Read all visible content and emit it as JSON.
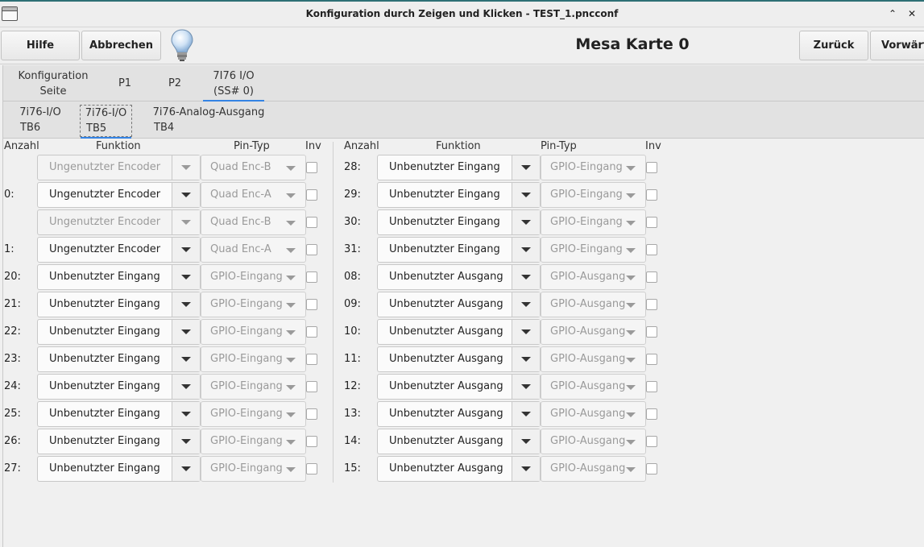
{
  "window": {
    "title": "Konfiguration durch Zeigen und Klicken - TEST_1.pncconf",
    "minimize_glyph": "⌃",
    "close_glyph": "✕"
  },
  "toolbar": {
    "help_label": "Hilfe",
    "cancel_label": "Abbrechen",
    "page_title": "Mesa Karte 0",
    "back_label": "Zurück",
    "forward_label": "Vorwärts"
  },
  "tabs_main": [
    {
      "line1": "Konfiguration",
      "line2": "Seite"
    },
    {
      "line1": "P1",
      "line2": ""
    },
    {
      "line1": "P2",
      "line2": ""
    },
    {
      "line1": "7I76 I/O",
      "line2": "(SS# 0)"
    }
  ],
  "tabs_sub": [
    {
      "line1": "7i76-I/O",
      "line2": "TB6"
    },
    {
      "line1": "7i76-I/O",
      "line2": "TB5"
    },
    {
      "line1": "7i76-Analog-Ausgang",
      "line2": "TB4"
    }
  ],
  "headers": {
    "count": "Anzahl",
    "function": "Funktion",
    "pintype": "Pin-Typ",
    "inv": "Inv"
  },
  "left_rows": [
    {
      "label": "",
      "func": "Ungenutzter Encoder",
      "func_disabled": true,
      "pintype": "Quad Enc-B"
    },
    {
      "label": "0:",
      "func": "Ungenutzter Encoder",
      "func_disabled": false,
      "pintype": "Quad Enc-A"
    },
    {
      "label": "",
      "func": "Ungenutzter Encoder",
      "func_disabled": true,
      "pintype": "Quad Enc-B"
    },
    {
      "label": "1:",
      "func": "Ungenutzter Encoder",
      "func_disabled": false,
      "pintype": "Quad Enc-A"
    },
    {
      "label": "20:",
      "func": "Unbenutzter Eingang",
      "func_disabled": false,
      "pintype": "GPIO-Eingang"
    },
    {
      "label": "21:",
      "func": "Unbenutzter Eingang",
      "func_disabled": false,
      "pintype": "GPIO-Eingang"
    },
    {
      "label": "22:",
      "func": "Unbenutzter Eingang",
      "func_disabled": false,
      "pintype": "GPIO-Eingang"
    },
    {
      "label": "23:",
      "func": "Unbenutzter Eingang",
      "func_disabled": false,
      "pintype": "GPIO-Eingang"
    },
    {
      "label": "24:",
      "func": "Unbenutzter Eingang",
      "func_disabled": false,
      "pintype": "GPIO-Eingang"
    },
    {
      "label": "25:",
      "func": "Unbenutzter Eingang",
      "func_disabled": false,
      "pintype": "GPIO-Eingang"
    },
    {
      "label": "26:",
      "func": "Unbenutzter Eingang",
      "func_disabled": false,
      "pintype": "GPIO-Eingang"
    },
    {
      "label": "27:",
      "func": "Unbenutzter Eingang",
      "func_disabled": false,
      "pintype": "GPIO-Eingang"
    }
  ],
  "right_rows": [
    {
      "label": "28:",
      "func": "Unbenutzter Eingang",
      "func_disabled": false,
      "pintype": "GPIO-Eingang"
    },
    {
      "label": "29:",
      "func": "Unbenutzter Eingang",
      "func_disabled": false,
      "pintype": "GPIO-Eingang"
    },
    {
      "label": "30:",
      "func": "Unbenutzter Eingang",
      "func_disabled": false,
      "pintype": "GPIO-Eingang"
    },
    {
      "label": "31:",
      "func": "Unbenutzter Eingang",
      "func_disabled": false,
      "pintype": "GPIO-Eingang"
    },
    {
      "label": "08:",
      "func": "Unbenutzter Ausgang",
      "func_disabled": false,
      "pintype": "GPIO-Ausgang"
    },
    {
      "label": "09:",
      "func": "Unbenutzter Ausgang",
      "func_disabled": false,
      "pintype": "GPIO-Ausgang"
    },
    {
      "label": "10:",
      "func": "Unbenutzter Ausgang",
      "func_disabled": false,
      "pintype": "GPIO-Ausgang"
    },
    {
      "label": "11:",
      "func": "Unbenutzter Ausgang",
      "func_disabled": false,
      "pintype": "GPIO-Ausgang"
    },
    {
      "label": "12:",
      "func": "Unbenutzter Ausgang",
      "func_disabled": false,
      "pintype": "GPIO-Ausgang"
    },
    {
      "label": "13:",
      "func": "Unbenutzter Ausgang",
      "func_disabled": false,
      "pintype": "GPIO-Ausgang"
    },
    {
      "label": "14:",
      "func": "Unbenutzter Ausgang",
      "func_disabled": false,
      "pintype": "GPIO-Ausgang"
    },
    {
      "label": "15:",
      "func": "Unbenutzter Ausgang",
      "func_disabled": false,
      "pintype": "GPIO-Ausgang"
    }
  ],
  "colors": {
    "accent": "#3584e4",
    "disabled_text": "#9a9a9a"
  }
}
